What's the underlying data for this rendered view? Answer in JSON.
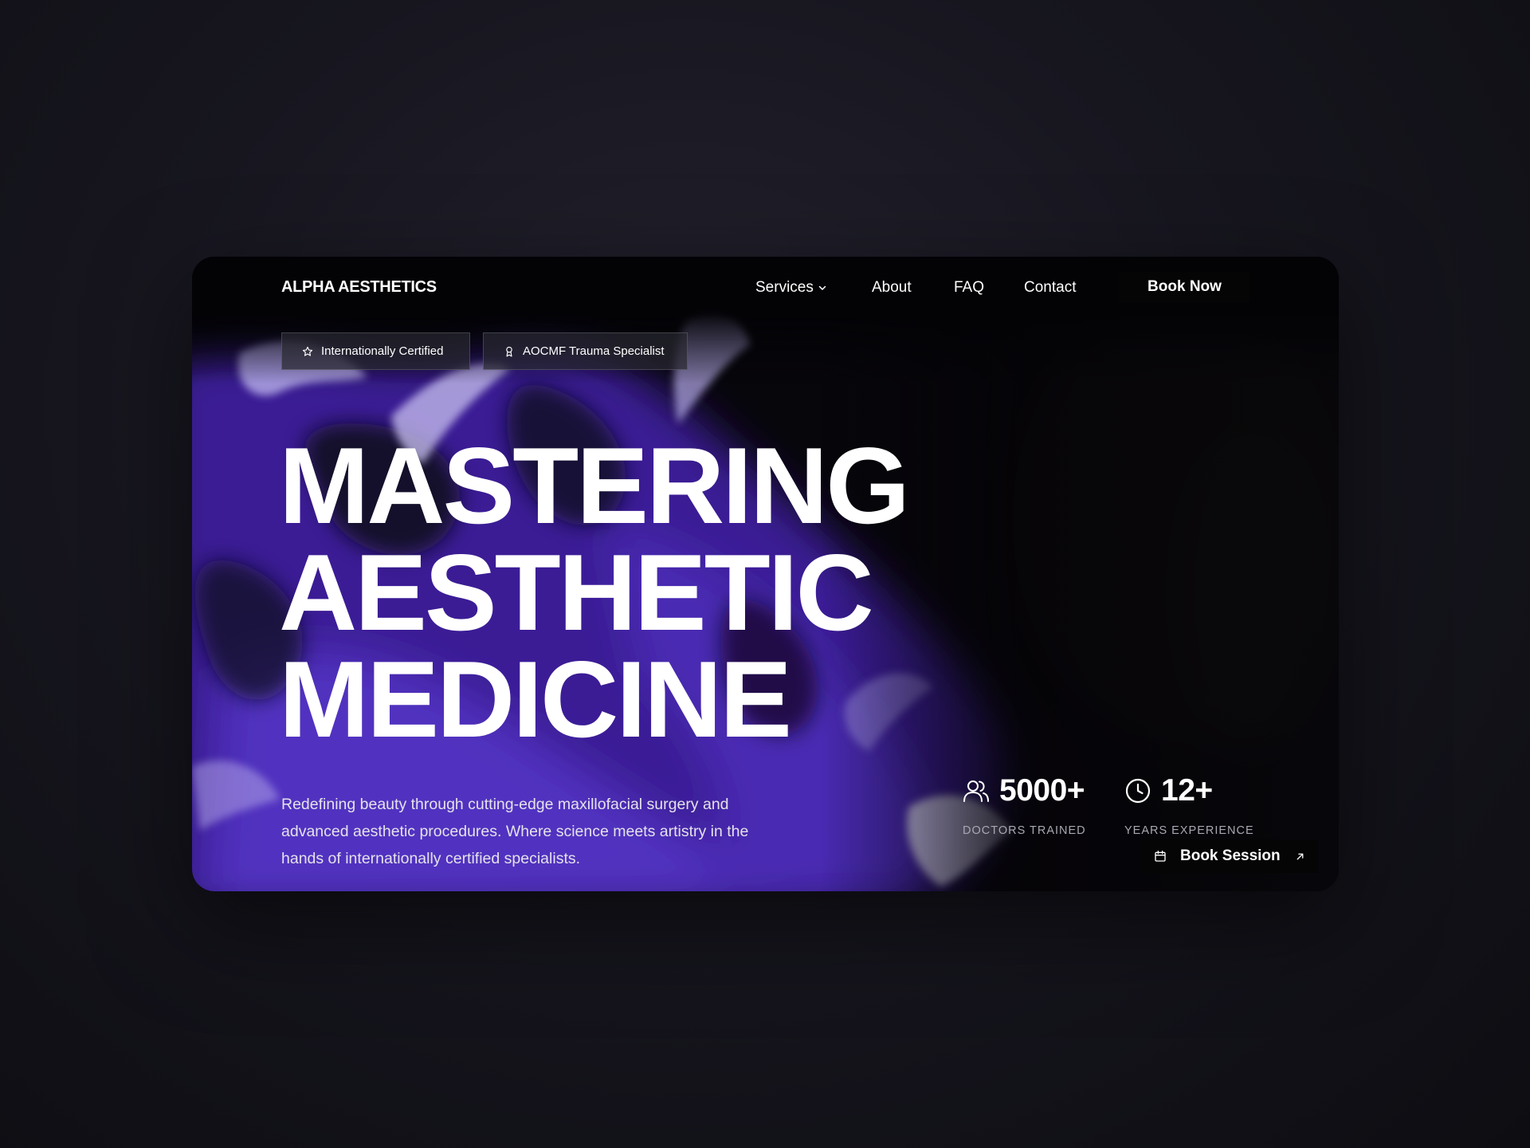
{
  "brand": {
    "name": "ALPHA AESTHETICS"
  },
  "nav": {
    "items": [
      {
        "label": "Services",
        "has_dropdown": true
      },
      {
        "label": "About"
      },
      {
        "label": "FAQ"
      },
      {
        "label": "Contact"
      }
    ],
    "cta_label": "Book Now"
  },
  "badges": [
    {
      "icon": "star-icon",
      "label": "Internationally Certified"
    },
    {
      "icon": "award-icon",
      "label": "AOCMF Trauma Specialist"
    }
  ],
  "hero": {
    "headline_lines": [
      "MASTERING",
      "AESTHETIC",
      "MEDICINE"
    ],
    "description": "Redefining beauty through cutting-edge maxillofacial surgery and advanced aesthetic procedures. Where science meets artistry in the hands of internationally certified specialists."
  },
  "stats": [
    {
      "icon": "users-icon",
      "value": "5000+",
      "label": "DOCTORS TRAINED"
    },
    {
      "icon": "clock-icon",
      "value": "12+",
      "label": "YEARS EXPERIENCE"
    }
  ],
  "book_session": {
    "icon": "calendar-icon",
    "label": "Book Session",
    "trailing_icon": "arrow-up-right-icon"
  },
  "colors": {
    "accent_purple": "#4b2fa8",
    "dark_background": "#060509",
    "text_primary": "#ffffff",
    "text_muted": "#a9a7b2"
  }
}
